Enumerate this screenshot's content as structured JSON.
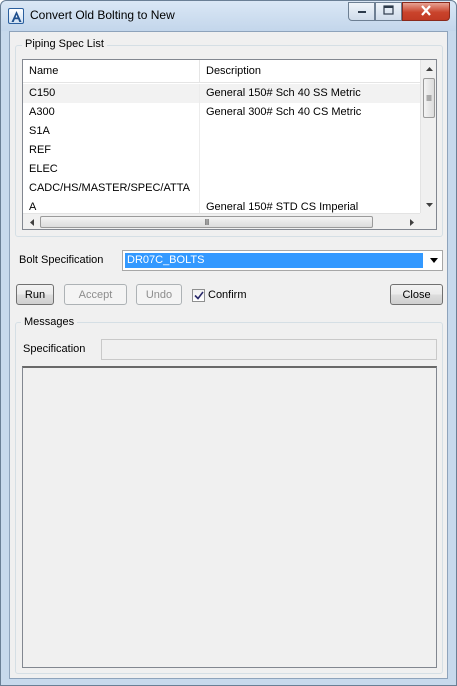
{
  "window": {
    "title": "Convert Old Bolting to New",
    "icons": {
      "app": "app-logo-icon",
      "minimize": "minimize-icon",
      "maximize": "maximize-icon",
      "close": "close-icon"
    }
  },
  "piping_spec_list": {
    "group_label": "Piping Spec List",
    "columns": [
      "Name",
      "Description"
    ],
    "rows": [
      {
        "name": "C150",
        "description": "General 150# Sch 40 SS Metric"
      },
      {
        "name": "A300",
        "description": "General 300# Sch 40 CS Metric"
      },
      {
        "name": "S1A",
        "description": ""
      },
      {
        "name": "REF",
        "description": ""
      },
      {
        "name": "ELEC",
        "description": ""
      },
      {
        "name": "CADC/HS/MASTER/SPEC/ATTA",
        "description": ""
      },
      {
        "name": "A",
        "description": "General 150# STD CS Imperial"
      }
    ],
    "scroll_thumb_glyph": "III"
  },
  "bolt_spec": {
    "label": "Bolt Specification",
    "value": "DR07C_BOLTS"
  },
  "actions": {
    "run": "Run",
    "accept": "Accept",
    "undo": "Undo",
    "confirm_label": "Confirm",
    "confirm_checked": true,
    "close": "Close"
  },
  "messages": {
    "group_label": "Messages",
    "spec_label": "Specification",
    "spec_value": ""
  },
  "colors": {
    "selection": "#3399ff",
    "frame": "#c7d9ec",
    "close_button": "#c9432b"
  }
}
